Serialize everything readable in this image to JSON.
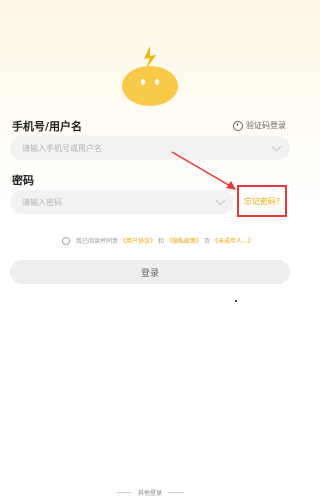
{
  "form": {
    "username_label": "手机号/用户名",
    "username_placeholder": "请输入手机号或用户名",
    "code_login_label": "验证码登录",
    "password_label": "密码",
    "password_placeholder": "请输入密码",
    "forgot_password_label": "忘记密码?",
    "agreement": {
      "prefix": "我已阅读并同意",
      "user_agreement": "《用户协议》",
      "and": "和",
      "privacy_policy": "《隐私政策》",
      "and2": "及",
      "children_policy": "《未成年人...》"
    },
    "login_button": "登录",
    "other_login": "其他登录"
  },
  "colors": {
    "accent": "#e9a300",
    "highlight_box": "#e23b3b",
    "mascot": "#f9c94a"
  }
}
